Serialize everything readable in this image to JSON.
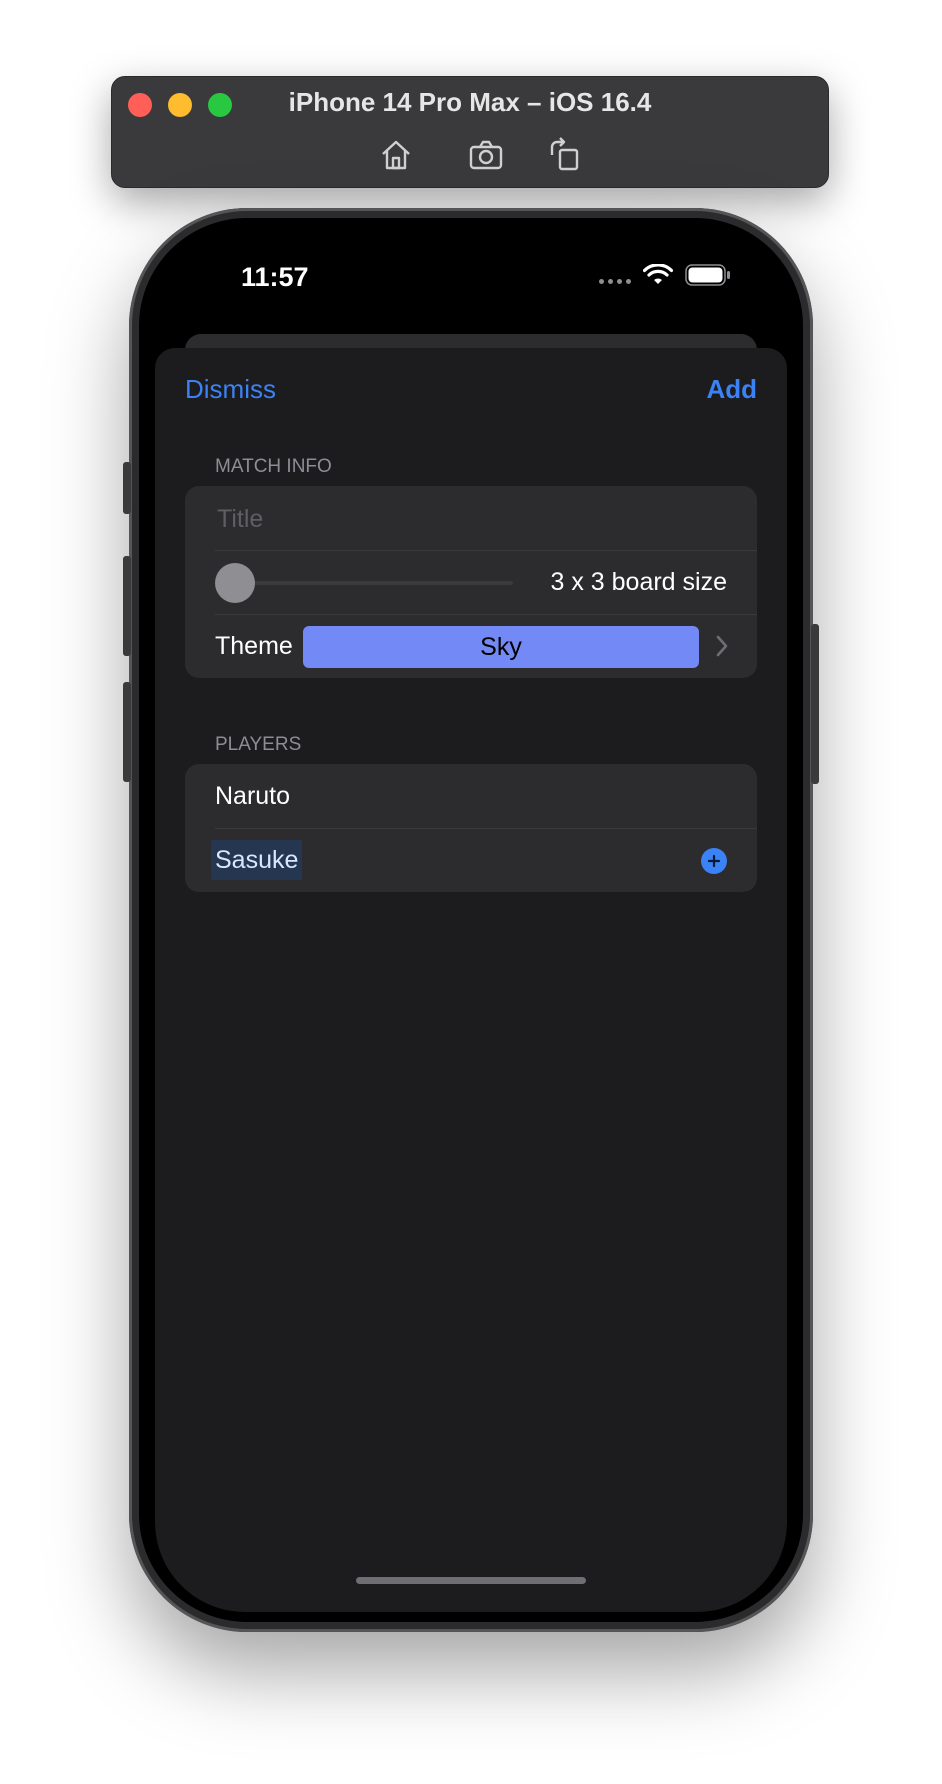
{
  "simulator": {
    "title": "iPhone 14 Pro Max – iOS 16.4",
    "tools": [
      "home-icon",
      "screenshot-icon",
      "rotate-icon"
    ]
  },
  "status_bar": {
    "time": "11:57",
    "icons": [
      "signal-icon",
      "wifi-icon",
      "battery-icon"
    ]
  },
  "nav": {
    "dismiss_label": "Dismiss",
    "add_label": "Add"
  },
  "match_info": {
    "header": "MATCH INFO",
    "title_placeholder": "Title",
    "title_value": "",
    "board_size_label": "3 x 3 board size",
    "board_size_slider_value": 0,
    "theme_label": "Theme",
    "theme_value": "Sky",
    "theme_color": "#7389f5"
  },
  "players": {
    "header": "PLAYERS",
    "items": [
      "Naruto",
      "Sasuke"
    ]
  },
  "colors": {
    "accent": "#3b82f6",
    "sheet_background": "#1c1c1e",
    "group_background": "#2c2c2e"
  }
}
